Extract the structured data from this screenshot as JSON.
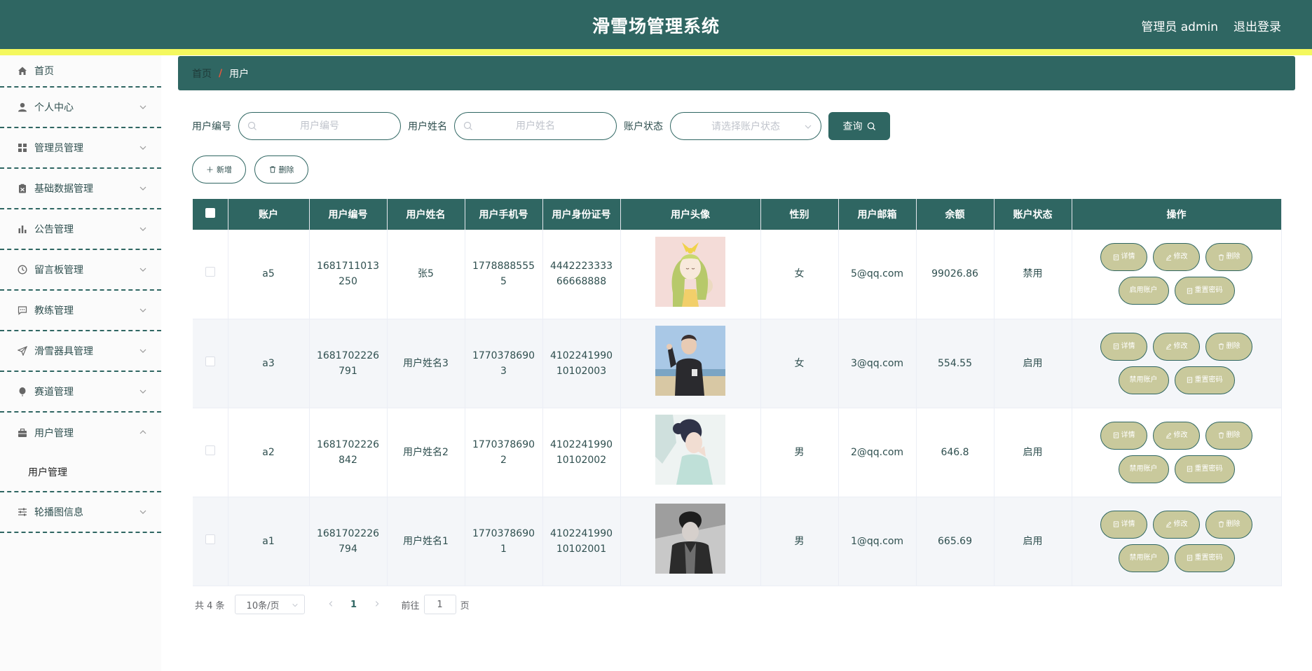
{
  "header": {
    "title": "滑雪场管理系统",
    "admin_label": "管理员 admin",
    "logout_label": "退出登录"
  },
  "sidebar": {
    "items": [
      {
        "label": "首页",
        "icon": "home-icon"
      },
      {
        "label": "个人中心",
        "icon": "user-icon"
      },
      {
        "label": "管理员管理",
        "icon": "grid-icon"
      },
      {
        "label": "基础数据管理",
        "icon": "clipboard-icon"
      },
      {
        "label": "公告管理",
        "icon": "bar-chart-icon"
      },
      {
        "label": "留言板管理",
        "icon": "clock-icon"
      },
      {
        "label": "教练管理",
        "icon": "chat-icon"
      },
      {
        "label": "滑雪器具管理",
        "icon": "send-icon"
      },
      {
        "label": "赛道管理",
        "icon": "balloon-icon"
      },
      {
        "label": "用户管理",
        "icon": "briefcase-icon"
      },
      {
        "label": "轮播图信息",
        "icon": "sliders-icon"
      }
    ],
    "submenu_user": "用户管理"
  },
  "breadcrumb": {
    "home": "首页",
    "separator": "/",
    "current": "用户"
  },
  "search": {
    "user_no_label": "用户编号",
    "user_no_placeholder": "用户编号",
    "user_name_label": "用户姓名",
    "user_name_placeholder": "用户姓名",
    "status_label": "账户状态",
    "status_placeholder": "请选择账户状态",
    "query_label": "查询"
  },
  "actions": {
    "add_label": "新增",
    "delete_label": "删除"
  },
  "table": {
    "headers": [
      "账户",
      "用户编号",
      "用户姓名",
      "用户手机号",
      "用户身份证号",
      "用户头像",
      "性别",
      "用户邮箱",
      "余额",
      "账户状态",
      "操作"
    ],
    "rows": [
      {
        "account": "a5",
        "user_no_1": "1681711013",
        "user_no_2": "250",
        "name": "张5",
        "phone_1": "1778888555",
        "phone_2": "5",
        "id_1": "4442223333",
        "id_2": "66668888",
        "gender": "女",
        "email": "5@qq.com",
        "balance": "99026.86",
        "status": "禁用",
        "toggle_label": "启用账户"
      },
      {
        "account": "a3",
        "user_no_1": "1681702226",
        "user_no_2": "791",
        "name": "用户姓名3",
        "phone_1": "1770378690",
        "phone_2": "3",
        "id_1": "4102241990",
        "id_2": "10102003",
        "gender": "女",
        "email": "3@qq.com",
        "balance": "554.55",
        "status": "启用",
        "toggle_label": "禁用账户"
      },
      {
        "account": "a2",
        "user_no_1": "1681702226",
        "user_no_2": "842",
        "name": "用户姓名2",
        "phone_1": "1770378690",
        "phone_2": "2",
        "id_1": "4102241990",
        "id_2": "10102002",
        "gender": "男",
        "email": "2@qq.com",
        "balance": "646.8",
        "status": "启用",
        "toggle_label": "禁用账户"
      },
      {
        "account": "a1",
        "user_no_1": "1681702226",
        "user_no_2": "794",
        "name": "用户姓名1",
        "phone_1": "1770378690",
        "phone_2": "1",
        "id_1": "4102241990",
        "id_2": "10102001",
        "gender": "男",
        "email": "1@qq.com",
        "balance": "665.69",
        "status": "启用",
        "toggle_label": "禁用账户"
      }
    ],
    "op_labels": {
      "detail": "详情",
      "edit": "修改",
      "delete": "删除",
      "reset": "重置密码"
    }
  },
  "pagination": {
    "total": "共 4 条",
    "page_size": "10条/页",
    "current_page": "1",
    "goto_label": "前往",
    "goto_value": "1",
    "page_suffix": "页"
  },
  "colors": {
    "primary": "#2f6662",
    "accent_strip": "#f4f85e",
    "op_button": "#c9c99c",
    "breadcrumb_sep": "#e8553c"
  }
}
